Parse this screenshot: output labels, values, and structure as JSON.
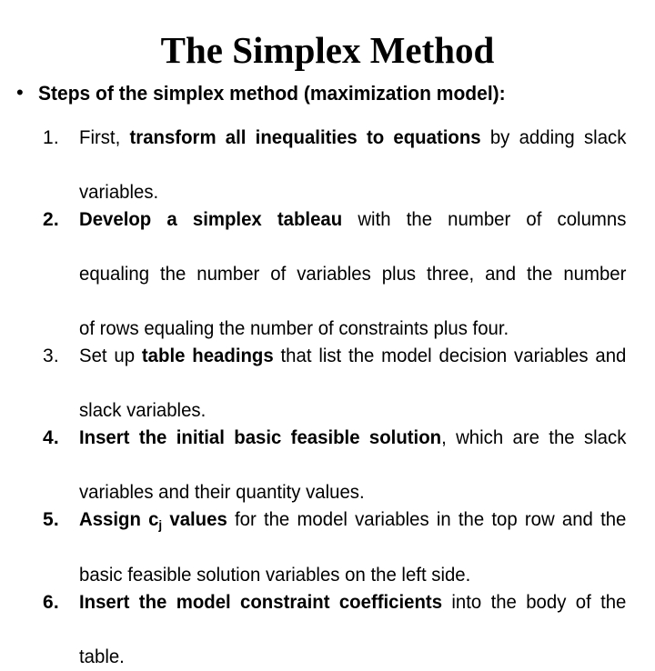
{
  "slide": {
    "title": "The Simplex Method",
    "bullet": {
      "marker": "•",
      "text": "Steps of the simplex method (maximization model):"
    },
    "steps": [
      {
        "number": "1.",
        "number_bold": false,
        "lines": [
          [
            {
              "text": "First, ",
              "bold": false
            },
            {
              "text": "transform all inequalities to equations",
              "bold": true
            },
            {
              "text": " by adding slack",
              "bold": false
            }
          ],
          [
            {
              "text": "variables.",
              "bold": false
            }
          ]
        ]
      },
      {
        "number": "2.",
        "number_bold": true,
        "lines": [
          [
            {
              "text": "Develop a simplex tableau",
              "bold": true
            },
            {
              "text": " with the number of columns",
              "bold": false
            }
          ],
          [
            {
              "text": "equaling the number of variables plus three, and the number",
              "bold": false
            }
          ],
          [
            {
              "text": "of rows equaling the number of constraints plus four.",
              "bold": false
            }
          ]
        ]
      },
      {
        "number": "3.",
        "number_bold": false,
        "lines": [
          [
            {
              "text": "Set up ",
              "bold": false
            },
            {
              "text": "table headings",
              "bold": true
            },
            {
              "text": " that list the model decision variables and",
              "bold": false
            }
          ],
          [
            {
              "text": "slack variables.",
              "bold": false
            }
          ]
        ]
      },
      {
        "number": "4.",
        "number_bold": true,
        "lines": [
          [
            {
              "text": "Insert the initial basic feasible solution",
              "bold": true
            },
            {
              "text": ", which are the slack",
              "bold": false
            }
          ],
          [
            {
              "text": "variables and their quantity values.",
              "bold": false
            }
          ]
        ]
      },
      {
        "number": "5.",
        "number_bold": true,
        "lines": [
          [
            {
              "text": "Assign c",
              "bold": true
            },
            {
              "text": "j",
              "bold": true,
              "sub": true
            },
            {
              "text": " values",
              "bold": true
            },
            {
              "text": " for the model variables in the top row and the",
              "bold": false
            }
          ],
          [
            {
              "text": "basic feasible solution variables on the left side.",
              "bold": false
            }
          ]
        ]
      },
      {
        "number": "6.",
        "number_bold": true,
        "lines": [
          [
            {
              "text": "Insert the model constraint coefficients",
              "bold": true
            },
            {
              "text": " into the body of the",
              "bold": false
            }
          ],
          [
            {
              "text": "table.",
              "bold": false
            }
          ]
        ]
      }
    ]
  },
  "colors": {
    "background": "#ffffff",
    "text": "#000000"
  }
}
